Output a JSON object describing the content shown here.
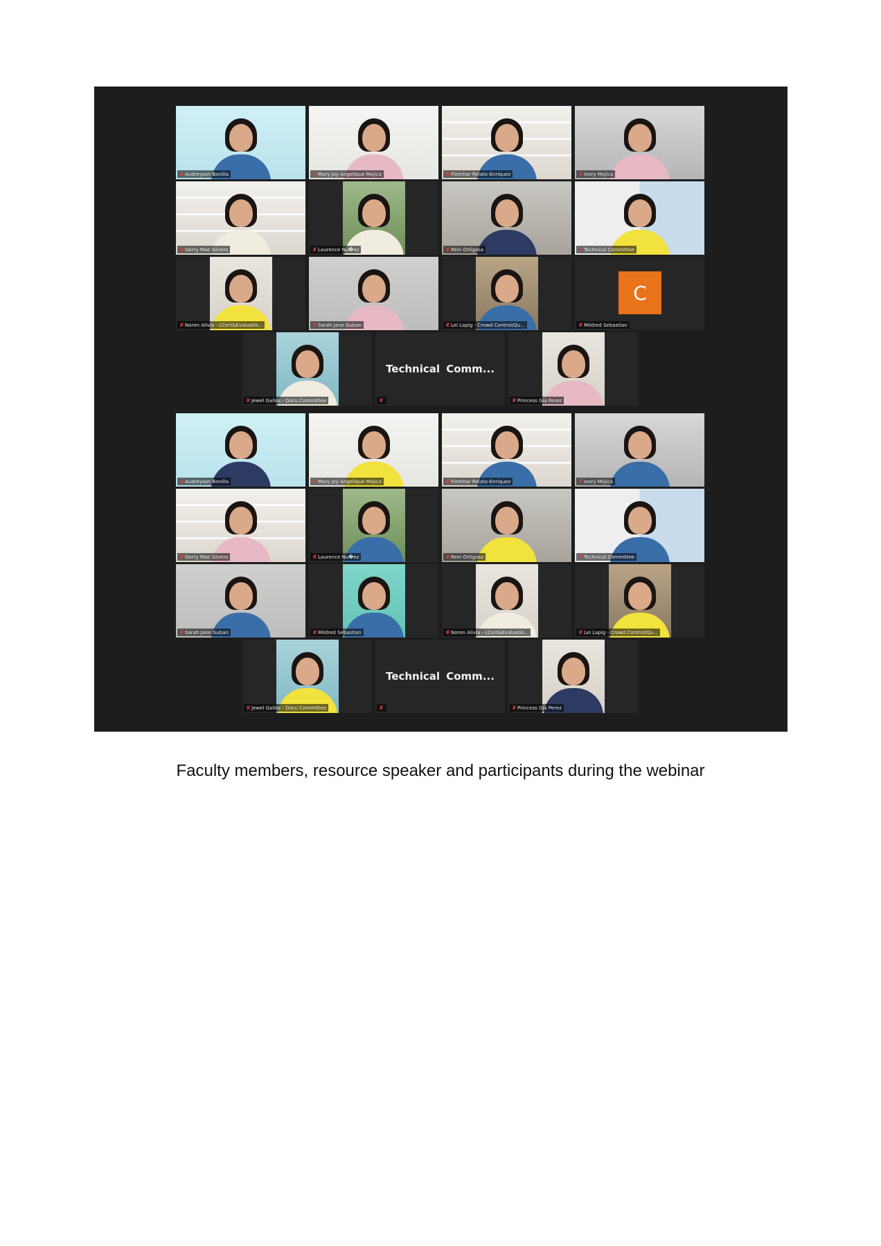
{
  "screens": [
    {
      "rows": [
        [
          {
            "name": "Audreyson Bonilla",
            "bg": "teal"
          },
          {
            "name": "Mary Joy Angelique Mojica",
            "bg": "white",
            "active": true
          },
          {
            "name": "Flemhar Relato-Enriquez",
            "bg": "shelf"
          },
          {
            "name": "Ivory Mojica",
            "bg": "office"
          }
        ],
        [
          {
            "name": "Gerry Mae Silvero",
            "bg": "shelf"
          },
          {
            "name": "Laurence Nu�ez",
            "bg": "green",
            "narrow": true
          },
          {
            "name": "Rein Ortigosa",
            "bg": "room"
          },
          {
            "name": "Technical Committee",
            "bg": "curtain"
          }
        ],
        [
          {
            "name": "Noren Alivia - LCert&Evaluatio...",
            "bg": "wall",
            "narrow": true
          },
          {
            "name": "Sarah Jane Guban",
            "bg": "grey"
          },
          {
            "name": "Lei Lapig - Crowd Control/Qu...",
            "bg": "crowd",
            "narrow": true
          },
          {
            "name": "Mildred Sebastian",
            "avatar": "C"
          }
        ]
      ],
      "bottom": [
        {
          "name": "Jewel Gallos - Docu Committee",
          "bg": "blueish",
          "narrow": true
        },
        {
          "name": "",
          "label": "Technical  Comm..."
        },
        {
          "name": "Princess Gia Perez",
          "bg": "wall",
          "narrow": true
        }
      ]
    },
    {
      "rows": [
        [
          {
            "name": "Audreyson Bonilla",
            "bg": "teal"
          },
          {
            "name": "Mary Joy Angelique Mojica",
            "bg": "white",
            "active": true
          },
          {
            "name": "Flemhar Relato-Enriquez",
            "bg": "shelf"
          },
          {
            "name": "Ivory Mojica",
            "bg": "office"
          }
        ],
        [
          {
            "name": "Gerry Mae Silvero",
            "bg": "shelf"
          },
          {
            "name": "Laurence Nu�ez",
            "bg": "green",
            "narrow": true
          },
          {
            "name": "Rein Ortigosa",
            "bg": "room"
          },
          {
            "name": "Technical Committee",
            "bg": "curtain"
          }
        ],
        [
          {
            "name": "Sarah Jane Guban",
            "bg": "grey"
          },
          {
            "name": "Mildred Sebastian",
            "bg": "mint",
            "narrow": true
          },
          {
            "name": "Noren Alivia - LCert&Evaluatio...",
            "bg": "wall",
            "narrow": true
          },
          {
            "name": "Lei Lapig - Crowd Control/Qu...",
            "bg": "crowd",
            "narrow": true
          }
        ]
      ],
      "bottom": [
        {
          "name": "Jewel Gallos - Docu Committee",
          "bg": "blueish",
          "narrow": true
        },
        {
          "name": "",
          "label": "Technical  Comm..."
        },
        {
          "name": "Princess Gia Perez",
          "bg": "wall",
          "narrow": true
        }
      ]
    }
  ],
  "caption": "Faculty members, resource speaker and participants during the webinar",
  "colors": {
    "background": "#1d1d1d",
    "active_border": "#c8e27a",
    "avatar": "#e8731a",
    "mic_muted": "#e0413a"
  },
  "icons": {
    "mic": "muted-mic-icon"
  }
}
